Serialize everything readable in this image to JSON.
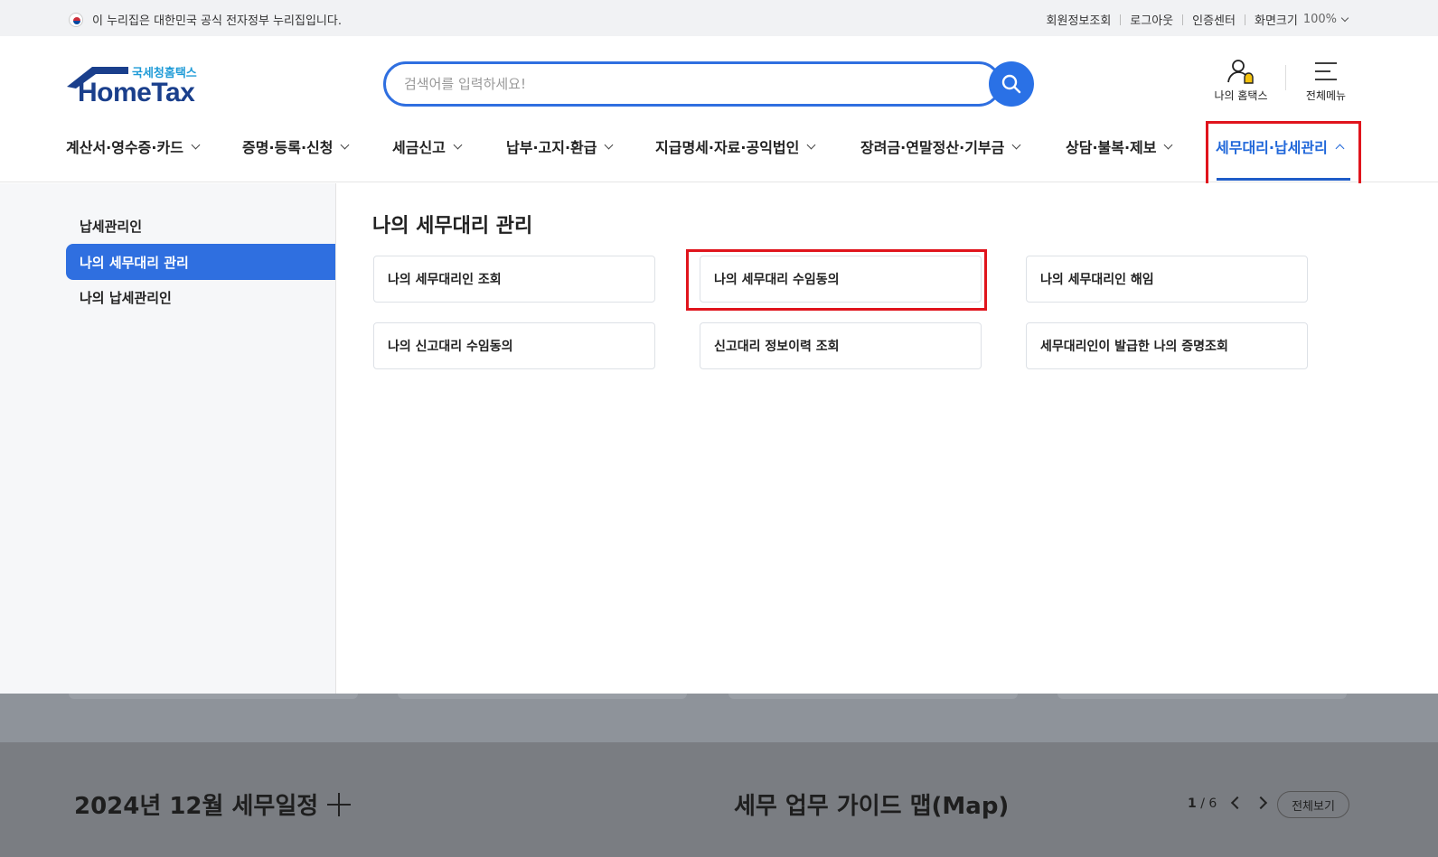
{
  "gov_banner": {
    "text": "이 누리집은 대한민국 공식 전자정부 누리집입니다.",
    "links": [
      "회원정보조회",
      "로그아웃",
      "인증센터"
    ],
    "zoom_label": "화면크기",
    "zoom_value": "100%"
  },
  "logo": {
    "sub": "국세청홈택스",
    "main": "HomeTax"
  },
  "search": {
    "placeholder": "검색어를 입력하세요!"
  },
  "header_links": {
    "my_hometax": "나의 홈택스",
    "all_menu": "전체메뉴"
  },
  "gnb": {
    "items": [
      "계산서·영수증·카드",
      "증명·등록·신청",
      "세금신고",
      "납부·고지·환급",
      "지급명세·자료·공익법인",
      "장려금·연말정산·기부금",
      "상담·불복·제보",
      "세무대리·납세관리"
    ],
    "active_index": 7
  },
  "side_menu": {
    "items": [
      "납세관리인",
      "나의 세무대리 관리",
      "나의 납세관리인"
    ],
    "active_index": 1
  },
  "panel": {
    "title": "나의 세무대리 관리",
    "cards": [
      "나의 세무대리인 조회",
      "나의 세무대리 수임동의",
      "나의 세무대리인 해임",
      "나의 신고대리 수임동의",
      "신고대리 정보이력 조회",
      "세무대리인이 발급한 나의 증명조회"
    ]
  },
  "background": {
    "schedule_title": "2024년 12월 세무일정",
    "guide_title": "세무 업무 가이드 맵(Map)",
    "pager_current": "1",
    "pager_total": "/ 6",
    "view_all": "전체보기"
  },
  "colors": {
    "primary": "#2f6fe0",
    "highlight": "#e0141c",
    "logo": "#1a3f8c"
  }
}
